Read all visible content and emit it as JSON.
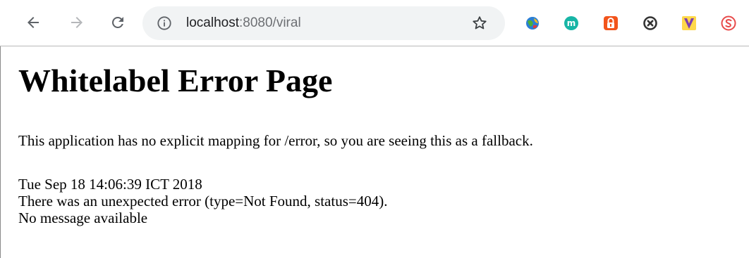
{
  "browser": {
    "url_host": "localhost",
    "url_rest": ":8080/viral",
    "nav_icons": [
      "arrow-left-icon",
      "arrow-right-icon",
      "reload-icon"
    ],
    "page_info_icon": "info-icon",
    "bookmark_icon": "star-icon",
    "extensions": [
      {
        "icon": "globe-extension-icon",
        "color": "#2a7fd4"
      },
      {
        "icon": "m-extension-icon",
        "color": "#17b5a6",
        "letter": "m"
      },
      {
        "icon": "lock-extension-icon",
        "color": "#f2541b"
      },
      {
        "icon": "close-circle-extension-icon",
        "color": "#333333"
      },
      {
        "icon": "v-extension-icon",
        "color": "#7d3fb0",
        "letter": "V"
      },
      {
        "icon": "s-extension-icon",
        "color": "#e84a4a",
        "letter": "S"
      }
    ]
  },
  "page": {
    "title": "Whitelabel Error Page",
    "description": "This application has no explicit mapping for /error, so you are seeing this as a fallback.",
    "timestamp": "Tue Sep 18 14:06:39 ICT 2018",
    "error_line": "There was an unexpected error (type=Not Found, status=404).",
    "message": "No message available"
  }
}
